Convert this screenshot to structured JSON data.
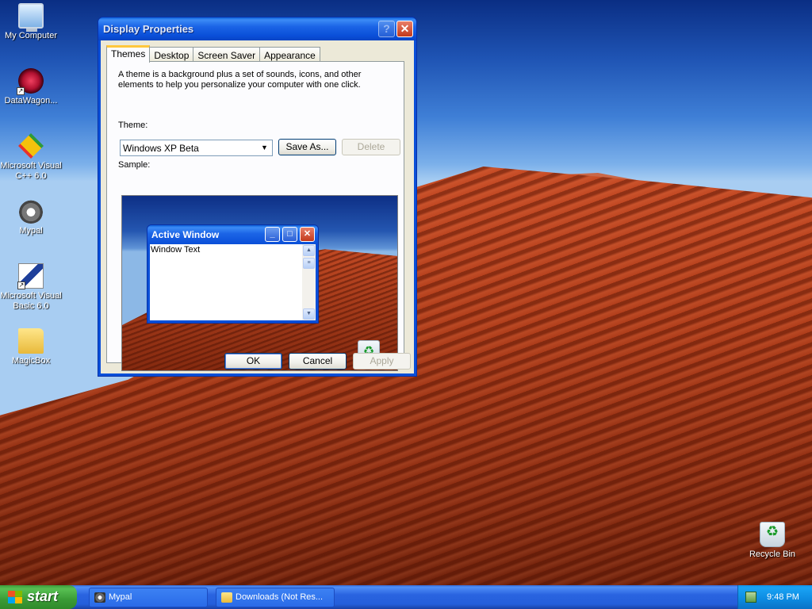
{
  "desktop": {
    "icons": [
      {
        "label": "My Computer",
        "icon": "my-computer-icon"
      },
      {
        "label": "DataWagon...",
        "icon": "datawagon-icon"
      },
      {
        "label": "Microsoft Visual C++ 6.0",
        "icon": "visual-cpp-icon"
      },
      {
        "label": "Mypal",
        "icon": "mypal-icon"
      },
      {
        "label": "Microsoft Visual Basic 6.0",
        "icon": "visual-basic-icon"
      },
      {
        "label": "MagicBox",
        "icon": "folder-icon"
      },
      {
        "label": "Recycle Bin",
        "icon": "recycle-bin-icon"
      }
    ]
  },
  "dialog": {
    "title": "Display Properties",
    "help_glyph": "?",
    "close_glyph": "✕",
    "tabs": [
      {
        "label": "Themes",
        "active": true
      },
      {
        "label": "Desktop",
        "active": false
      },
      {
        "label": "Screen Saver",
        "active": false
      },
      {
        "label": "Appearance",
        "active": false
      }
    ],
    "description": "A theme is a background plus a set of sounds, icons, and other elements to help you personalize your computer with one click.",
    "theme_label": "Theme:",
    "theme_value": "Windows XP Beta",
    "save_as_label": "Save As...",
    "delete_label": "Delete",
    "sample_label": "Sample:",
    "sample": {
      "window_title": "Active Window",
      "window_text": "Window Text"
    },
    "ok_label": "OK",
    "cancel_label": "Cancel",
    "apply_label": "Apply"
  },
  "taskbar": {
    "start_label": "start",
    "tasks": [
      {
        "label": "Mypal",
        "icon": "mypal-icon"
      },
      {
        "label": "Downloads (Not Res...",
        "icon": "folder-icon"
      }
    ],
    "clock": "9:48 PM"
  },
  "colors": {
    "titlebar": "#0a4fd8",
    "dialog_face": "#ece9d8",
    "active_tab_accent": "#ffc83c",
    "start_green": "#3a9b36",
    "taskbar_blue": "#245edb",
    "tray_blue": "#0d8ae0"
  }
}
